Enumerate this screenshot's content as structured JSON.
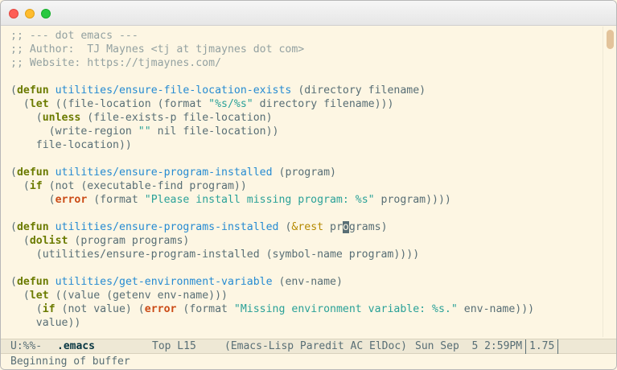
{
  "window": {
    "buttons": {
      "close": "close-icon",
      "minimize": "minimize-icon",
      "maximize": "maximize-icon"
    }
  },
  "buffer": {
    "lines": [
      [
        {
          "t": ";; --- dot emacs ---",
          "s": "comment"
        }
      ],
      [
        {
          "t": ";; Author:  TJ Maynes <tj at tjmaynes dot com>",
          "s": "comment"
        }
      ],
      [
        {
          "t": ";; Website: https://tjmaynes.com/",
          "s": "comment"
        }
      ],
      [],
      [
        {
          "t": "(",
          "s": ""
        },
        {
          "t": "defun",
          "s": "kw"
        },
        {
          "t": " ",
          "s": ""
        },
        {
          "t": "utilities/ensure-file-location-exists",
          "s": "fn"
        },
        {
          "t": " (directory filename)",
          "s": ""
        }
      ],
      [
        {
          "t": "  (",
          "s": ""
        },
        {
          "t": "let",
          "s": "kw"
        },
        {
          "t": " ((file-location (format ",
          "s": ""
        },
        {
          "t": "\"%s/%s\"",
          "s": "str"
        },
        {
          "t": " directory filename)))",
          "s": ""
        }
      ],
      [
        {
          "t": "    (",
          "s": ""
        },
        {
          "t": "unless",
          "s": "kw"
        },
        {
          "t": " (file-exists-p file-location)",
          "s": ""
        }
      ],
      [
        {
          "t": "      (write-region ",
          "s": ""
        },
        {
          "t": "\"\"",
          "s": "str"
        },
        {
          "t": " nil file-location))",
          "s": ""
        }
      ],
      [
        {
          "t": "    file-location))",
          "s": ""
        }
      ],
      [],
      [
        {
          "t": "(",
          "s": ""
        },
        {
          "t": "defun",
          "s": "kw"
        },
        {
          "t": " ",
          "s": ""
        },
        {
          "t": "utilities/ensure-program-installed",
          "s": "fn"
        },
        {
          "t": " (program)",
          "s": ""
        }
      ],
      [
        {
          "t": "  (",
          "s": ""
        },
        {
          "t": "if",
          "s": "kw"
        },
        {
          "t": " (not (executable-find program))",
          "s": ""
        }
      ],
      [
        {
          "t": "      (",
          "s": ""
        },
        {
          "t": "error",
          "s": "err"
        },
        {
          "t": " (format ",
          "s": ""
        },
        {
          "t": "\"Please install missing program: %s\"",
          "s": "str"
        },
        {
          "t": " program))))",
          "s": ""
        }
      ],
      [],
      [
        {
          "t": "(",
          "s": ""
        },
        {
          "t": "defun",
          "s": "kw"
        },
        {
          "t": " ",
          "s": ""
        },
        {
          "t": "utilities/ensure-programs-installed",
          "s": "fn"
        },
        {
          "t": " (",
          "s": ""
        },
        {
          "t": "&rest",
          "s": "rest"
        },
        {
          "t": " pr",
          "s": ""
        },
        {
          "t": "o",
          "s": "cursor"
        },
        {
          "t": "grams)",
          "s": ""
        }
      ],
      [
        {
          "t": "  (",
          "s": ""
        },
        {
          "t": "dolist",
          "s": "kw"
        },
        {
          "t": " (program programs)",
          "s": ""
        }
      ],
      [
        {
          "t": "    (utilities/ensure-program-installed (symbol-name program))))",
          "s": ""
        }
      ],
      [],
      [
        {
          "t": "(",
          "s": ""
        },
        {
          "t": "defun",
          "s": "kw"
        },
        {
          "t": " ",
          "s": ""
        },
        {
          "t": "utilities/get-environment-variable",
          "s": "fn"
        },
        {
          "t": " (env-name)",
          "s": ""
        }
      ],
      [
        {
          "t": "  (",
          "s": ""
        },
        {
          "t": "let",
          "s": "kw"
        },
        {
          "t": " ((value (getenv env-name)))",
          "s": ""
        }
      ],
      [
        {
          "t": "    (",
          "s": ""
        },
        {
          "t": "if",
          "s": "kw"
        },
        {
          "t": " (not value) (",
          "s": ""
        },
        {
          "t": "error",
          "s": "err"
        },
        {
          "t": " (format ",
          "s": ""
        },
        {
          "t": "\"Missing environment variable: %s.\"",
          "s": "str"
        },
        {
          "t": " env-name)))",
          "s": ""
        }
      ],
      [
        {
          "t": "    value))",
          "s": ""
        }
      ]
    ]
  },
  "modeline": {
    "state": "U:%%-",
    "buffer_name": ".emacs",
    "position": "Top L15",
    "modes": "(Emacs-Lisp Paredit AC ElDoc)",
    "datetime": "Sun Sep  5 2:59PM",
    "load": "1.75"
  },
  "echo_area": {
    "message": "Beginning of buffer"
  }
}
